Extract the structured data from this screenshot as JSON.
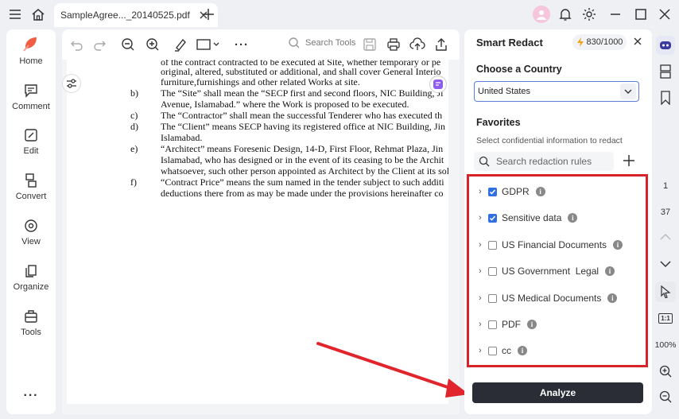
{
  "tab": {
    "title": "SampleAgree..._20140525.pdf"
  },
  "sidebar": {
    "items": [
      {
        "label": "Home"
      },
      {
        "label": "Comment"
      },
      {
        "label": "Edit"
      },
      {
        "label": "Convert"
      },
      {
        "label": "View"
      },
      {
        "label": "Organize"
      },
      {
        "label": "Tools"
      }
    ]
  },
  "toolbar": {
    "search_label": "Search Tools"
  },
  "document": {
    "lines": [
      "of the contract contracted to be executed at Site, whether temporary or pe",
      "original, altered, substituted or additional, and shall cover General Interio",
      "furniture,furnishings and other related Works at site.",
      "The “Site” shall mean the “SECP first and second floors, NIC Building, Ji",
      "Avenue, Islamabad.” where the Work is proposed to be executed.",
      "The “Contractor” shall mean the successful Tenderer who has executed th",
      "The “Client” means SECP having its registered office at NIC Building, Jin",
      "Islamabad.",
      "“Architect” means Foresenic Design, 14-D, First Floor, Rehmat Plaza, Jin",
      "Islamabad, who has designed or in the event of its ceasing to be the Archit",
      "whatsoever, such other person appointed as Architect by the Client at its sol",
      "“Contract Price” means the sum named in the tender subject to such additi",
      "deductions there from as may be made under the provisions hereinafter co"
    ],
    "labels": [
      "b)",
      "c)",
      "d)",
      "e)",
      "f)"
    ]
  },
  "panel": {
    "title": "Smart Redact",
    "credits": "830/1000",
    "country_heading": "Choose a Country",
    "country_value": "United States",
    "favorites_heading": "Favorites",
    "favorites_sub": "Select confidential information to redact",
    "search_placeholder": "Search redaction rules",
    "rules": [
      {
        "label": "GDPR",
        "checked": true
      },
      {
        "label": "Sensitive data",
        "checked": true
      },
      {
        "label": "US Financial Documents",
        "checked": false
      },
      {
        "label": "US Government  Legal",
        "checked": false
      },
      {
        "label": "US Medical Documents",
        "checked": false
      },
      {
        "label": "PDF",
        "checked": false
      },
      {
        "label": "cc",
        "checked": false
      }
    ],
    "analyze_label": "Analyze"
  },
  "rightrail": {
    "page_current": "1",
    "page_total": "37",
    "zoom": "100%",
    "fit_label": "1:1"
  },
  "colors": {
    "accent": "#2f6fe0",
    "highlight_box": "#d8232a",
    "analyze_bg": "#2a2d36",
    "arrow": "#e0252d"
  }
}
